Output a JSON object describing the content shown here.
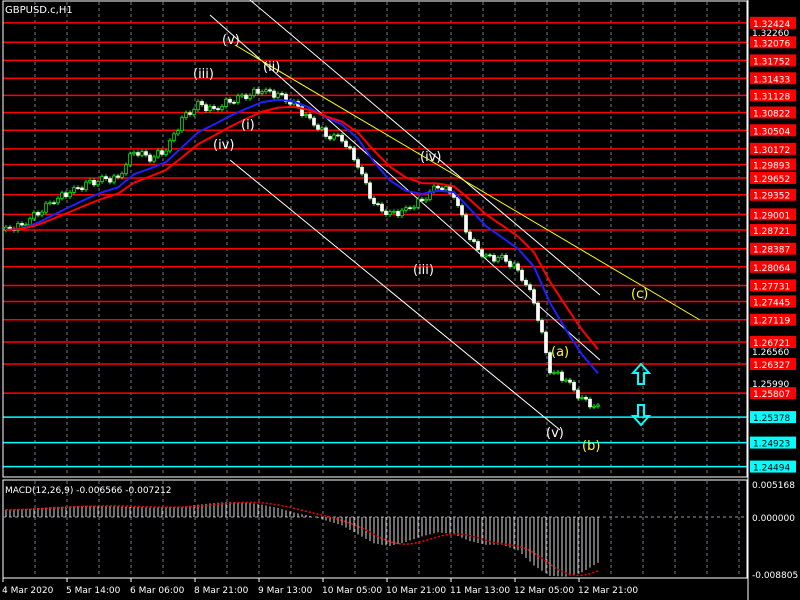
{
  "symbol_title": "GBPUSD.c,H1",
  "colors": {
    "background": "#000000",
    "bull": "#00ff00",
    "level_red": "#ff0000",
    "level_cyan": "#00ffff",
    "ma_red": "#ff0000",
    "ma_blue": "#2020ff",
    "trend_yellow": "#ffff00",
    "macd_signal": "#ff0000",
    "arrow_cyan": "#00ffff"
  },
  "chart_data": {
    "type": "candlestick",
    "title": "GBPUSD.c,H1",
    "ylim": [
      1.24,
      1.3266
    ],
    "closes": [
      1.2872,
      1.2881,
      1.2904,
      1.2926,
      1.294,
      1.2953,
      1.2962,
      1.2965,
      1.3015,
      1.3001,
      1.3015,
      1.3069,
      1.3096,
      1.3087,
      1.3104,
      1.3113,
      1.3122,
      1.3113,
      1.3096,
      1.3069,
      1.3042,
      1.3037,
      1.2988,
      1.2917,
      1.2899,
      1.2908,
      1.2926,
      1.2953,
      1.2935,
      1.2854,
      1.2822,
      1.2822,
      1.2801,
      1.2747,
      1.2622,
      1.2604,
      1.2568,
      1.2554
    ],
    "red_levels": [
      "1.32424",
      "1.32076",
      "1.31752",
      "1.31433",
      "1.31128",
      "1.30822",
      "1.30504",
      "1.30172",
      "1.29893",
      "1.29652",
      "1.29352",
      "1.29001",
      "1.28721",
      "1.28387",
      "1.28064",
      "1.27731",
      "1.27445",
      "1.27119",
      "1.26721",
      "1.26327",
      "1.25807"
    ],
    "cyan_levels": [
      "1.25378",
      "1.24923",
      "1.24494"
    ],
    "axis_ticks": [
      "1.32260",
      "1.26560",
      "1.25990"
    ],
    "x_ticks": [
      "4 Mar 2020",
      "5 Mar 14:00",
      "6 Mar 06:00",
      "8 Mar 21:00",
      "9 Mar 13:00",
      "10 Mar 05:00",
      "10 Mar 21:00",
      "11 Mar 13:00",
      "12 Mar 05:00",
      "12 Mar 21:00"
    ],
    "wave_labels": [
      "(v)",
      "(iii)",
      "(ii)",
      "(i)",
      "(iv)",
      "(iv)",
      "(iii)",
      "(a)",
      "(v)",
      "(b)",
      "(c)"
    ],
    "macd": {
      "label": "MACD(12,26,9) -0.006566 -0.007212",
      "ylim": [
        -0.008805,
        0.005168
      ],
      "axis_ticks": [
        "0.005168",
        "0.000000",
        "-0.008805"
      ],
      "histogram": [
        0.0013,
        0.0014,
        0.0016,
        0.0018,
        0.0019,
        0.002,
        0.002,
        0.0019,
        0.0018,
        0.0017,
        0.0018,
        0.0018,
        0.0022,
        0.0025,
        0.0027,
        0.0026,
        0.0022,
        0.0016,
        0.0008,
        0.0002,
        -0.0005,
        -0.0012,
        -0.0025,
        -0.0038,
        -0.0042,
        -0.0036,
        -0.0028,
        -0.0022,
        -0.0025,
        -0.0035,
        -0.004,
        -0.004,
        -0.0048,
        -0.007,
        -0.0085,
        -0.0086,
        -0.008,
        -0.0066
      ]
    }
  }
}
